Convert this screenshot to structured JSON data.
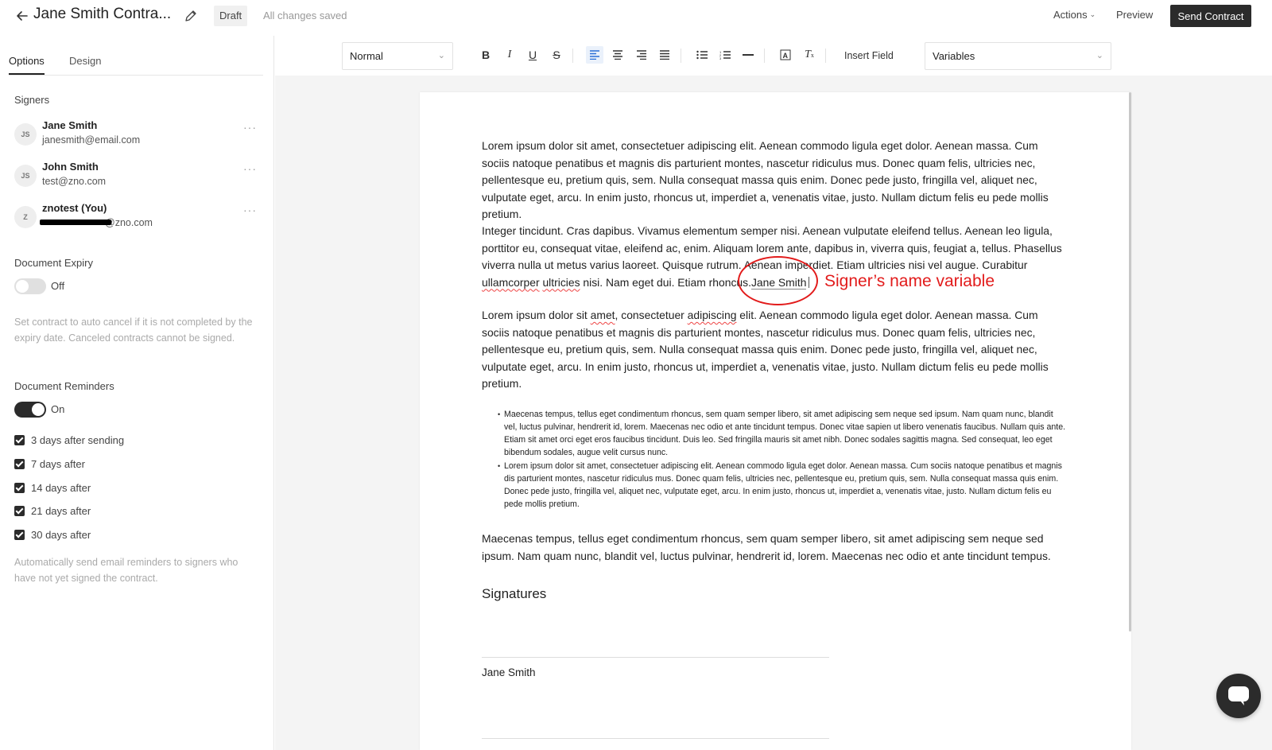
{
  "header": {
    "title": "Jane Smith Contra...",
    "status_badge": "Draft",
    "save_status": "All changes saved",
    "actions_label": "Actions",
    "preview_label": "Preview",
    "send_label": "Send Contract"
  },
  "sidebar": {
    "tabs": [
      {
        "label": "Options"
      },
      {
        "label": "Design"
      }
    ],
    "signers_heading": "Signers",
    "signers": [
      {
        "initials": "JS",
        "name": "Jane Smith",
        "email": "janesmith@email.com"
      },
      {
        "initials": "JS",
        "name": "John Smith",
        "email": "test@zno.com"
      },
      {
        "initials": "Z",
        "name": "znotest (You)",
        "email": "@zno.com"
      }
    ],
    "expiry": {
      "heading": "Document Expiry",
      "state_label": "Off",
      "help": "Set contract to auto cancel if it is not completed by the expiry date. Canceled contracts cannot be signed."
    },
    "reminders": {
      "heading": "Document Reminders",
      "state_label": "On",
      "options": [
        {
          "label": "3 days after sending"
        },
        {
          "label": "7 days after"
        },
        {
          "label": "14 days after"
        },
        {
          "label": "21 days after"
        },
        {
          "label": "30 days after"
        }
      ],
      "help": "Automatically send email reminders to signers who have not yet signed the contract."
    }
  },
  "toolbar": {
    "style_select": "Normal",
    "insert_field_label": "Insert Field",
    "variables_select": "Variables"
  },
  "document": {
    "p1": "Lorem ipsum dolor sit amet, consectetuer adipiscing elit. Aenean commodo ligula eget dolor. Aenean massa. Cum sociis natoque penatibus et magnis dis parturient montes, nascetur ridiculus mus. Donec quam felis, ultricies nec, pellentesque eu, pretium quis, sem. Nulla consequat massa quis enim. Donec pede justo, fringilla vel, aliquet nec, vulputate eget, arcu. In enim justo, rhoncus ut, imperdiet a, venenatis vitae, justo. Nullam dictum felis eu pede mollis pretium.",
    "p2_a": "Integer tincidunt. Cras dapibus. Vivamus elementum semper nisi. Aenean vulputate eleifend tellus. Aenean leo ligula, porttitor eu, consequat vitae, eleifend ac, enim. Aliquam lorem ante, dapibus in, viverra quis, feugiat a, tellus. Phasellus viverra nulla ut metus varius laoreet. Quisque rutrum. Aenean imperdiet. Etiam ultricies nisi vel augue. Curabitur ",
    "p2_sq1": "ullamcorper",
    "p2_sp": " ",
    "p2_sq2": "ultricies",
    "p2_b": " nisi. Nam eget dui. Etiam rhoncus.",
    "p2_var": "Jane Smith",
    "p3_a": "Lorem ipsum dolor sit ",
    "p3_sq1": "amet",
    "p3_b": ", consectetuer ",
    "p3_sq2": "adipiscing",
    "p3_c": " elit. Aenean commodo ligula eget dolor. Aenean massa. Cum sociis natoque penatibus et magnis dis parturient montes, nascetur ridiculus mus. Donec quam felis, ultricies nec, pellentesque eu, pretium quis, sem. Nulla consequat massa quis enim. Donec pede justo, fringilla vel, aliquet nec, vulputate eget, arcu. In enim justo, rhoncus ut, imperdiet a, venenatis vitae, justo. Nullam dictum felis eu pede mollis pretium.",
    "bullets": [
      "Maecenas tempus, tellus eget condimentum rhoncus, sem quam semper libero, sit amet adipiscing sem neque sed ipsum. Nam quam nunc, blandit vel, luctus pulvinar, hendrerit id, lorem. Maecenas nec odio et ante tincidunt tempus. Donec vitae sapien ut libero venenatis faucibus. Nullam quis ante. Etiam sit amet orci eget eros faucibus tincidunt. Duis leo. Sed fringilla mauris sit amet nibh. Donec sodales sagittis magna. Sed consequat, leo eget bibendum sodales, augue velit cursus nunc.",
      "Lorem ipsum dolor sit amet, consectetuer adipiscing elit. Aenean commodo ligula eget dolor. Aenean massa. Cum sociis natoque penatibus et magnis dis parturient montes, nascetur ridiculus mus. Donec quam felis, ultricies nec, pellentesque eu, pretium quis, sem. Nulla consequat massa quis enim. Donec pede justo, fringilla vel, aliquet nec, vulputate eget, arcu. In enim justo, rhoncus ut, imperdiet a, venenatis vitae, justo. Nullam dictum felis eu pede mollis pretium."
    ],
    "p4": "Maecenas tempus, tellus eget condimentum rhoncus, sem quam semper libero, sit amet adipiscing sem neque sed ipsum. Nam quam nunc, blandit vel, luctus pulvinar, hendrerit id, lorem. Maecenas nec odio et ante tincidunt tempus.",
    "signatures_heading": "Signatures",
    "signature_name": "Jane Smith"
  },
  "annotation": {
    "label": "Signer’s name variable",
    "color": "#e21b1b"
  },
  "colors": {
    "primary_button": "#2b2b2b",
    "canvas_bg": "#f4f4f4",
    "toolbar_active": "#eaf1fb"
  },
  "icons": {
    "back": "arrow-left-icon",
    "edit": "pencil-icon",
    "chat": "chat-bubble-icon"
  }
}
